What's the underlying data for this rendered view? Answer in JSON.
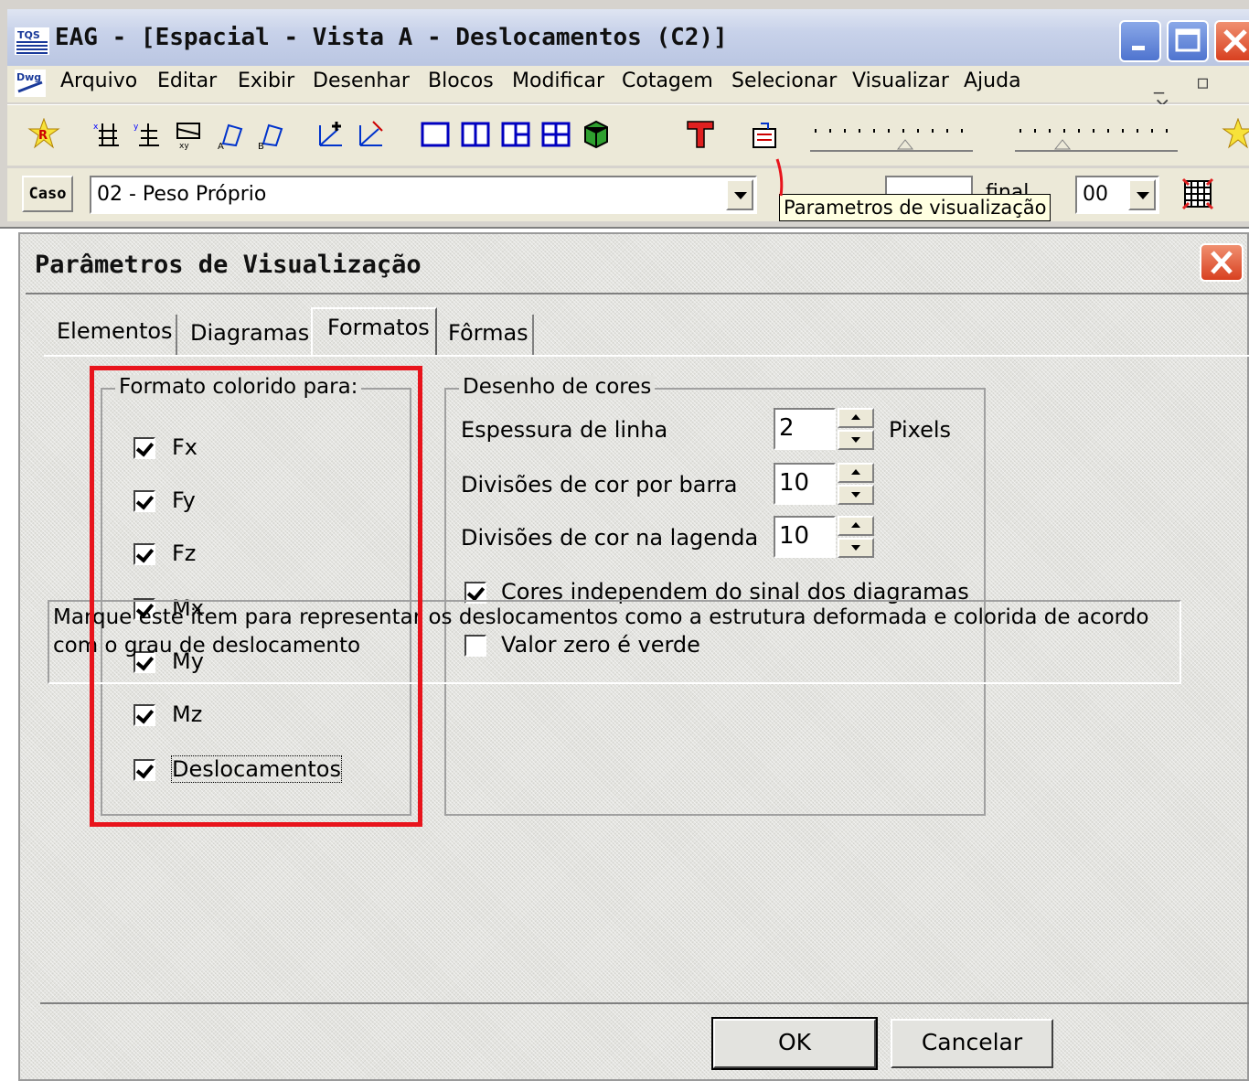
{
  "app": {
    "title": "EAG - [Espacial - Vista A - Deslocamentos (C2)]",
    "icon_label": "TQS"
  },
  "menu": {
    "items": [
      "Arquivo",
      "Editar",
      "Exibir",
      "Desenhar",
      "Blocos",
      "Modificar",
      "Cotagem",
      "Selecionar",
      "Visualizar",
      "Ajuda"
    ],
    "dwg_icon": "Dwg"
  },
  "casebar": {
    "caso_label": "Caso",
    "caso_value": "02 - Peso Próprio",
    "final_label": "final",
    "final_value": "00",
    "tooltip": "Parametros de visualização"
  },
  "dialog": {
    "title": "Parâmetros de Visualização",
    "tabs": [
      "Elementos",
      "Diagramas",
      "Formatos",
      "Fôrmas"
    ],
    "active_tab": "Formatos",
    "formato": {
      "legend": "Formato colorido para:",
      "items": [
        {
          "label": "Fx",
          "checked": true
        },
        {
          "label": "Fy",
          "checked": true
        },
        {
          "label": "Fz",
          "checked": true
        },
        {
          "label": "Mx",
          "checked": true
        },
        {
          "label": "My",
          "checked": true
        },
        {
          "label": "Mz",
          "checked": true
        },
        {
          "label": "Deslocamentos",
          "checked": true
        }
      ]
    },
    "cores": {
      "legend": "Desenho de cores",
      "espessura_label": "Espessura de linha",
      "espessura_value": "2",
      "espessura_unit": "Pixels",
      "div_barra_label": "Divisões de cor por barra",
      "div_barra_value": "10",
      "div_legenda_label": "Divisões de cor na lagenda",
      "div_legenda_value": "10",
      "independem_label": "Cores independem do sinal dos diagramas",
      "independem_checked": true,
      "zero_verde_label": "Valor zero é verde",
      "zero_verde_checked": false
    },
    "hint": "Marque este item para representar os deslocamentos como a estrutura deformada e colorida de acordo com o grau de deslocamento",
    "ok_label": "OK",
    "cancel_label": "Cancelar"
  },
  "colors": {
    "highlight_red": "#e8141c",
    "dialog_bg": "#e3e3df",
    "titlebar_blue": "#bac6e2"
  }
}
